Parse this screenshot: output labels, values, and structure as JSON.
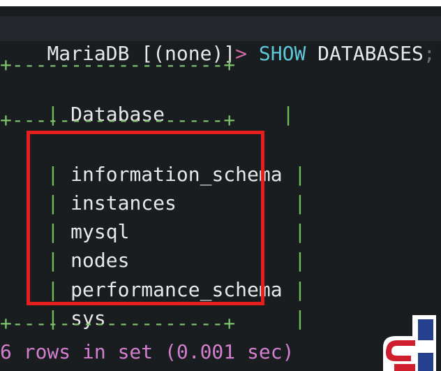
{
  "prompt": {
    "label": "MariaDB [(none)]",
    "arrow": ">",
    "keyword": "SHOW",
    "command": " DATABASES",
    "terminator": ";"
  },
  "table": {
    "border": "+------------------+",
    "header": "Database",
    "rows": [
      "information_schema",
      "instances",
      "mysql",
      "nodes",
      "performance_schema",
      "sys"
    ]
  },
  "footer": "6 rows in set (0.001 sec)",
  "colors": {
    "background": "#1a1d1f",
    "table_border": "#7fc26d",
    "command": "#5ec7d8",
    "footer": "#d27fd0",
    "highlight": "#e51e1e"
  },
  "logo": {
    "icon": "sb-logo-icon"
  }
}
